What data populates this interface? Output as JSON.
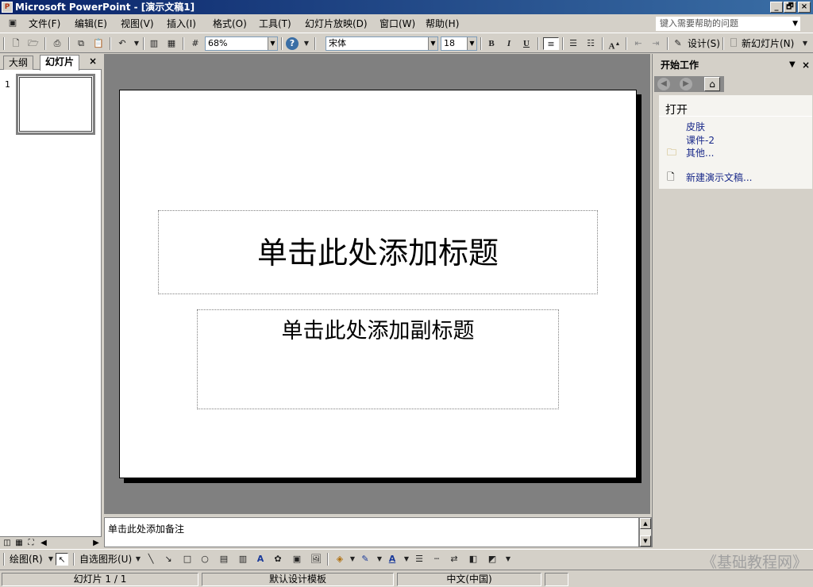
{
  "window": {
    "title": "Microsoft PowerPoint - [演示文稿1]",
    "app_icon": "powerpoint-app-icon",
    "controls": {
      "minimize": "_",
      "restore": "🗗",
      "close": "×"
    }
  },
  "menu": {
    "items": [
      {
        "label": "文件(F)"
      },
      {
        "label": "编辑(E)"
      },
      {
        "label": "视图(V)"
      },
      {
        "label": "插入(I)"
      },
      {
        "label": "格式(O)"
      },
      {
        "label": "工具(T)"
      },
      {
        "label": "幻灯片放映(D)"
      },
      {
        "label": "窗口(W)"
      },
      {
        "label": "帮助(H)"
      }
    ],
    "help_placeholder": "键入需要帮助的问题"
  },
  "toolbar": {
    "zoom": "68%",
    "font_name": "宋体",
    "font_size": "18",
    "bold": "B",
    "italic": "I",
    "underline": "U",
    "design_label": "设计(S)",
    "new_slide_label": "新幻灯片(N)"
  },
  "left_pane": {
    "tabs": [
      {
        "label": "大纲"
      },
      {
        "label": "幻灯片"
      }
    ],
    "active_tab": "幻灯片",
    "slide_number": "1"
  },
  "slide": {
    "title_placeholder": "单击此处添加标题",
    "subtitle_placeholder": "单击此处添加副标题"
  },
  "notes": {
    "placeholder": "单击此处添加备注"
  },
  "task_pane": {
    "title": "开始工作",
    "section_title": "打开",
    "files": [
      {
        "label": "皮肤"
      },
      {
        "label": "课件-2"
      }
    ],
    "more_label": "其他...",
    "new_presentation_label": "新建演示文稿..."
  },
  "drawing_toolbar": {
    "draw_label": "绘图(R)",
    "autoshapes_label": "自选图形(U)",
    "watermark": "《基础教程网》"
  },
  "status_bar": {
    "slide_info": "幻灯片 1 / 1",
    "template": "默认设计模板",
    "language": "中文(中国)"
  }
}
